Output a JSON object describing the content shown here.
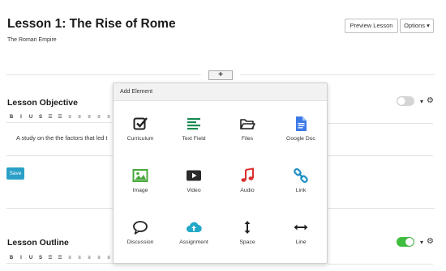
{
  "header": {
    "title": "Lesson 1: The Rise of Rome",
    "subtitle": "The Roman Empire",
    "preview_label": "Preview Lesson",
    "options_label": "Options ▾"
  },
  "add_button_label": "+",
  "objective": {
    "title": "Lesson Objective",
    "toggle_state": "off",
    "toolbar": [
      "B",
      "I",
      "U",
      "S",
      "☰",
      "☰",
      "≡",
      "≡",
      "≡",
      "≡",
      "≡"
    ],
    "text": "A study on the the factors that led t",
    "save_label": "Save"
  },
  "outline": {
    "title": "Lesson Outline",
    "toggle_state": "on",
    "toolbar": [
      "B",
      "I",
      "U",
      "S",
      "☰",
      "☰",
      "≡",
      "≡",
      "≡",
      "≡",
      "≡"
    ]
  },
  "popup": {
    "title": "Add Element",
    "items": [
      {
        "label": "Curriculum",
        "icon": "checkbox-icon",
        "color": "#222222"
      },
      {
        "label": "Text Field",
        "icon": "text-lines-icon",
        "color": "#1a8a52"
      },
      {
        "label": "Files",
        "icon": "folder-icon",
        "color": "#222222"
      },
      {
        "label": "Google Doc",
        "icon": "google-doc-icon",
        "color": "#3d7ae8"
      },
      {
        "label": "Image",
        "icon": "image-icon",
        "color": "#49a83e"
      },
      {
        "label": "Video",
        "icon": "video-icon",
        "color": "#2b2b2b"
      },
      {
        "label": "Audio",
        "icon": "music-note-icon",
        "color": "#d9302c"
      },
      {
        "label": "Link",
        "icon": "link-icon",
        "color": "#1e8fc2"
      },
      {
        "label": "Discussion",
        "icon": "speech-bubble-icon",
        "color": "#222222"
      },
      {
        "label": "Assignment",
        "icon": "cloud-upload-icon",
        "color": "#22a8c8"
      },
      {
        "label": "Space",
        "icon": "vertical-arrows-icon",
        "color": "#222222"
      },
      {
        "label": "Line",
        "icon": "horizontal-arrows-icon",
        "color": "#222222"
      }
    ]
  }
}
